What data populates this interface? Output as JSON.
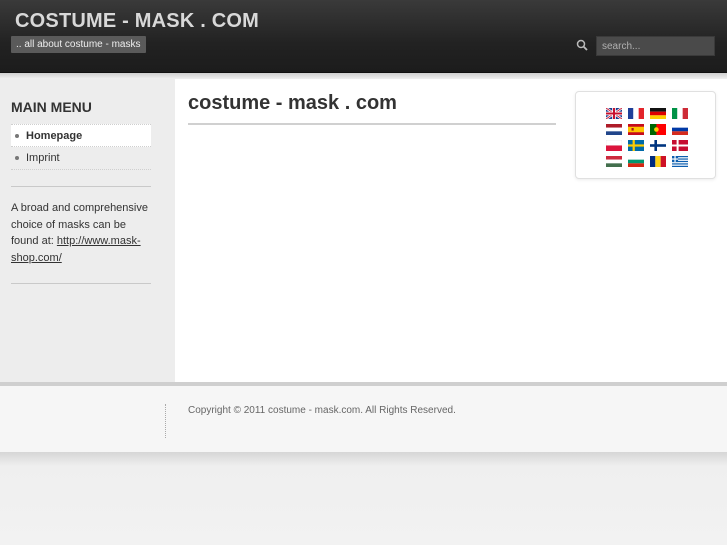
{
  "header": {
    "site_title": "COSTUME - MASK . COM",
    "tagline": ".. all about costume - masks",
    "search_placeholder": "search..."
  },
  "sidebar": {
    "menu_title": "MAIN MENU",
    "items": [
      {
        "label": "Homepage",
        "active": true
      },
      {
        "label": "Imprint",
        "active": false
      }
    ],
    "text_before_link": "A broad and comprehensive choice of masks can be found at: ",
    "link_text": "http://www.mask-shop.com/"
  },
  "main": {
    "title": "costume - mask . com"
  },
  "languages": [
    {
      "icon": "uk-flag-icon"
    },
    {
      "icon": "france-flag-icon"
    },
    {
      "icon": "germany-flag-icon"
    },
    {
      "icon": "italy-flag-icon"
    },
    {
      "icon": "netherlands-flag-icon"
    },
    {
      "icon": "spain-flag-icon"
    },
    {
      "icon": "portugal-flag-icon"
    },
    {
      "icon": "russia-flag-icon"
    },
    {
      "icon": "poland-flag-icon"
    },
    {
      "icon": "sweden-flag-icon"
    },
    {
      "icon": "finland-flag-icon"
    },
    {
      "icon": "denmark-flag-icon"
    },
    {
      "icon": "hungary-flag-icon"
    },
    {
      "icon": "bulgaria-flag-icon"
    },
    {
      "icon": "romania-flag-icon"
    },
    {
      "icon": "greece-flag-icon"
    }
  ],
  "footer": {
    "copyright": "Copyright © 2011 costume - mask.com. All Rights Reserved."
  },
  "colors": {
    "header_bg": "#222222",
    "title_text": "#d8d8d8",
    "tagline_bg": "#5a5a5a",
    "sidebar_bg": "#ededed",
    "content_bg": "#ffffff"
  }
}
